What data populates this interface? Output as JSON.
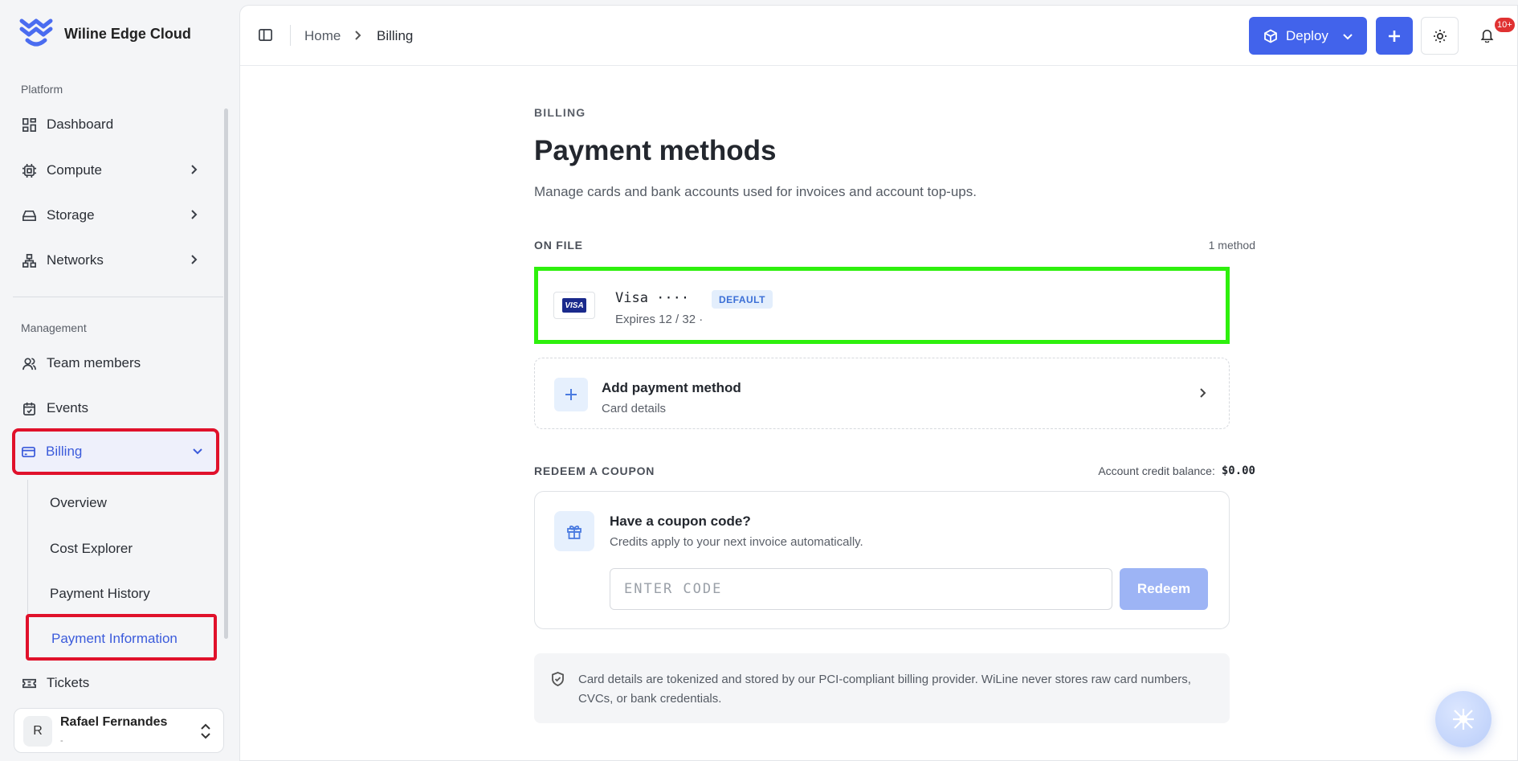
{
  "app": {
    "name": "Wiline Edge Cloud"
  },
  "sidebar": {
    "platform_label": "Platform",
    "platform_items": [
      {
        "label": "Dashboard",
        "icon": "dashboard-icon"
      },
      {
        "label": "Compute",
        "icon": "cpu-icon"
      },
      {
        "label": "Storage",
        "icon": "storage-icon"
      },
      {
        "label": "Networks",
        "icon": "network-icon"
      }
    ],
    "management_label": "Management",
    "management_items": [
      {
        "label": "Team members",
        "icon": "users-icon"
      },
      {
        "label": "Events",
        "icon": "calendar-check-icon"
      },
      {
        "label": "Billing",
        "icon": "credit-card-icon"
      },
      {
        "label": "Tickets",
        "icon": "ticket-icon"
      }
    ],
    "billing_sub": [
      "Overview",
      "Cost Explorer",
      "Payment History",
      "Payment Information"
    ],
    "user": {
      "initial": "R",
      "name": "Rafael Fernandes",
      "sub": "-"
    }
  },
  "topbar": {
    "breadcrumb": [
      "Home",
      "Billing"
    ],
    "deploy_label": "Deploy",
    "notifications_badge": "10+"
  },
  "page": {
    "eyebrow": "BILLING",
    "title": "Payment methods",
    "subtitle": "Manage cards and bank accounts used for invoices and account top-ups."
  },
  "on_file": {
    "label": "ON FILE",
    "count": "1 method",
    "card": {
      "brand_logo": "VISA",
      "title": "Visa ····",
      "badge": "DEFAULT",
      "expiry": "Expires 12 / 32 ·"
    }
  },
  "add_method": {
    "title": "Add payment method",
    "subtitle": "Card details"
  },
  "coupon": {
    "label": "REDEEM A COUPON",
    "balance_label": "Account credit balance:",
    "balance_value": "$0.00",
    "title": "Have a coupon code?",
    "subtitle": "Credits apply to your next invoice automatically.",
    "placeholder": "ENTER CODE",
    "button": "Redeem"
  },
  "notice": "Card details are tokenized and stored by our PCI-compliant billing provider. WiLine never stores raw card numbers, CVCs, or bank credentials.",
  "colors": {
    "accent": "#4263eb",
    "active_nav": "#3b5bdb",
    "highlight_green": "#2ef00d",
    "highlight_red": "#e0112b",
    "redeem_disabled": "#9db4f5"
  }
}
